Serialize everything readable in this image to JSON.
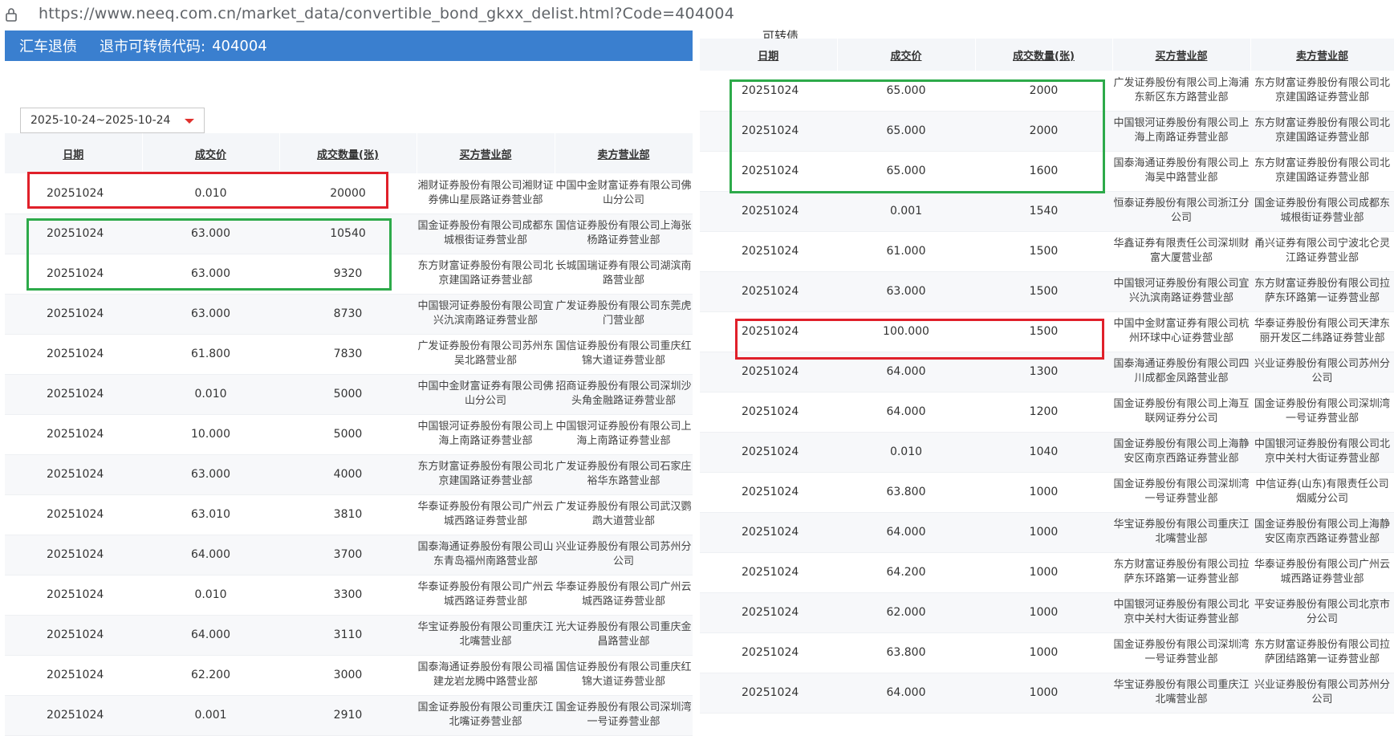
{
  "browser": {
    "url": "https://www.neeq.com.cn/market_data/convertible_bond_gkxx_delist.html?Code=404004"
  },
  "header": {
    "bond_name": "汇车退债",
    "code_label": "退市可转债代码:",
    "code_value": "404004"
  },
  "filter": {
    "date_range": "2025-10-24~2025-10-24"
  },
  "right_top_label": "可转债",
  "columns": [
    "日期",
    "成交价",
    "成交数量(张)",
    "买方营业部",
    "卖方营业部"
  ],
  "left_rows": [
    {
      "date": "20251024",
      "price": "0.010",
      "qty": "20000",
      "buyer": "湘财证券股份有限公司湘财证券佛山星辰路证券营业部",
      "seller": "中国中金财富证券有限公司佛山分公司"
    },
    {
      "date": "20251024",
      "price": "63.000",
      "qty": "10540",
      "buyer": "国金证券股份有限公司成都东城根街证券营业部",
      "seller": "国信证券股份有限公司上海张杨路证券营业部"
    },
    {
      "date": "20251024",
      "price": "63.000",
      "qty": "9320",
      "buyer": "东方财富证券股份有限公司北京建国路证券营业部",
      "seller": "长城国瑞证券有限公司湖滨南路营业部"
    },
    {
      "date": "20251024",
      "price": "63.000",
      "qty": "8730",
      "buyer": "中国银河证券股份有限公司宜兴氿滨南路证券营业部",
      "seller": "广发证券股份有限公司东莞虎门营业部"
    },
    {
      "date": "20251024",
      "price": "61.800",
      "qty": "7830",
      "buyer": "广发证券股份有限公司苏州东吴北路营业部",
      "seller": "国信证券股份有限公司重庆红锦大道证券营业部"
    },
    {
      "date": "20251024",
      "price": "0.010",
      "qty": "5000",
      "buyer": "中国中金财富证券有限公司佛山分公司",
      "seller": "招商证券股份有限公司深圳沙头角金融路证券营业部"
    },
    {
      "date": "20251024",
      "price": "10.000",
      "qty": "5000",
      "buyer": "中国银河证券股份有限公司上海上南路证券营业部",
      "seller": "中国银河证券股份有限公司上海上南路证券营业部"
    },
    {
      "date": "20251024",
      "price": "63.000",
      "qty": "4000",
      "buyer": "东方财富证券股份有限公司北京建国路证券营业部",
      "seller": "广发证券股份有限公司石家庄裕华东路营业部"
    },
    {
      "date": "20251024",
      "price": "63.010",
      "qty": "3810",
      "buyer": "华泰证券股份有限公司广州云城西路证券营业部",
      "seller": "广发证券股份有限公司武汉鹦鹉大道营业部"
    },
    {
      "date": "20251024",
      "price": "64.000",
      "qty": "3700",
      "buyer": "国泰海通证券股份有限公司山东青岛福州南路营业部",
      "seller": "兴业证券股份有限公司苏州分公司"
    },
    {
      "date": "20251024",
      "price": "0.010",
      "qty": "3300",
      "buyer": "华泰证券股份有限公司广州云城西路证券营业部",
      "seller": "华泰证券股份有限公司广州云城西路证券营业部"
    },
    {
      "date": "20251024",
      "price": "64.000",
      "qty": "3110",
      "buyer": "华宝证券股份有限公司重庆江北嘴营业部",
      "seller": "光大证券股份有限公司重庆金昌路营业部"
    },
    {
      "date": "20251024",
      "price": "62.200",
      "qty": "3000",
      "buyer": "国泰海通证券股份有限公司福建龙岩龙腾中路营业部",
      "seller": "国信证券股份有限公司重庆红锦大道证券营业部"
    },
    {
      "date": "20251024",
      "price": "0.001",
      "qty": "2910",
      "buyer": "国金证券股份有限公司重庆江北嘴证券营业部",
      "seller": "国金证券股份有限公司深圳湾一号证券营业部"
    }
  ],
  "right_rows": [
    {
      "date": "20251024",
      "price": "65.000",
      "qty": "2000",
      "buyer": "广发证券股份有限公司上海浦东新区东方路营业部",
      "seller": "东方财富证券股份有限公司北京建国路证券营业部"
    },
    {
      "date": "20251024",
      "price": "65.000",
      "qty": "2000",
      "buyer": "中国银河证券股份有限公司上海上南路证券营业部",
      "seller": "东方财富证券股份有限公司北京建国路证券营业部"
    },
    {
      "date": "20251024",
      "price": "65.000",
      "qty": "1600",
      "buyer": "国泰海通证券股份有限公司上海吴中路营业部",
      "seller": "东方财富证券股份有限公司北京建国路证券营业部"
    },
    {
      "date": "20251024",
      "price": "0.001",
      "qty": "1540",
      "buyer": "恒泰证券股份有限公司浙江分公司",
      "seller": "国金证券股份有限公司成都东城根街证券营业部"
    },
    {
      "date": "20251024",
      "price": "61.000",
      "qty": "1500",
      "buyer": "华鑫证券有限责任公司深圳财富大厦营业部",
      "seller": "甬兴证券有限公司宁波北仑灵江路证券营业部"
    },
    {
      "date": "20251024",
      "price": "63.000",
      "qty": "1500",
      "buyer": "中国银河证券股份有限公司宜兴氿滨南路证券营业部",
      "seller": "东方财富证券股份有限公司拉萨东环路第一证券营业部"
    },
    {
      "date": "20251024",
      "price": "100.000",
      "qty": "1500",
      "buyer": "中国中金财富证券有限公司杭州环球中心证券营业部",
      "seller": "华泰证券股份有限公司天津东丽开发区二纬路证券营业部"
    },
    {
      "date": "20251024",
      "price": "64.000",
      "qty": "1300",
      "buyer": "国泰海通证券股份有限公司四川成都金凤路营业部",
      "seller": "兴业证券股份有限公司苏州分公司"
    },
    {
      "date": "20251024",
      "price": "64.000",
      "qty": "1200",
      "buyer": "国金证券股份有限公司上海互联网证券分公司",
      "seller": "国金证券股份有限公司深圳湾一号证券营业部"
    },
    {
      "date": "20251024",
      "price": "0.010",
      "qty": "1040",
      "buyer": "国金证券股份有限公司上海静安区南京西路证券营业部",
      "seller": "中国银河证券股份有限公司北京中关村大街证券营业部"
    },
    {
      "date": "20251024",
      "price": "63.800",
      "qty": "1000",
      "buyer": "国金证券股份有限公司深圳湾一号证券营业部",
      "seller": "中信证券(山东)有限责任公司烟威分公司"
    },
    {
      "date": "20251024",
      "price": "64.000",
      "qty": "1000",
      "buyer": "华宝证券股份有限公司重庆江北嘴营业部",
      "seller": "国金证券股份有限公司上海静安区南京西路证券营业部"
    },
    {
      "date": "20251024",
      "price": "64.200",
      "qty": "1000",
      "buyer": "东方财富证券股份有限公司拉萨东环路第一证券营业部",
      "seller": "华泰证券股份有限公司广州云城西路证券营业部"
    },
    {
      "date": "20251024",
      "price": "62.000",
      "qty": "1000",
      "buyer": "中国银河证券股份有限公司北京中关村大街证券营业部",
      "seller": "平安证券股份有限公司北京市分公司"
    },
    {
      "date": "20251024",
      "price": "63.800",
      "qty": "1000",
      "buyer": "国金证券股份有限公司深圳湾一号证券营业部",
      "seller": "东方财富证券股份有限公司拉萨团结路第一证券营业部"
    },
    {
      "date": "20251024",
      "price": "64.000",
      "qty": "1000",
      "buyer": "华宝证券股份有限公司重庆江北嘴营业部",
      "seller": "兴业证券股份有限公司苏州分公司"
    }
  ]
}
